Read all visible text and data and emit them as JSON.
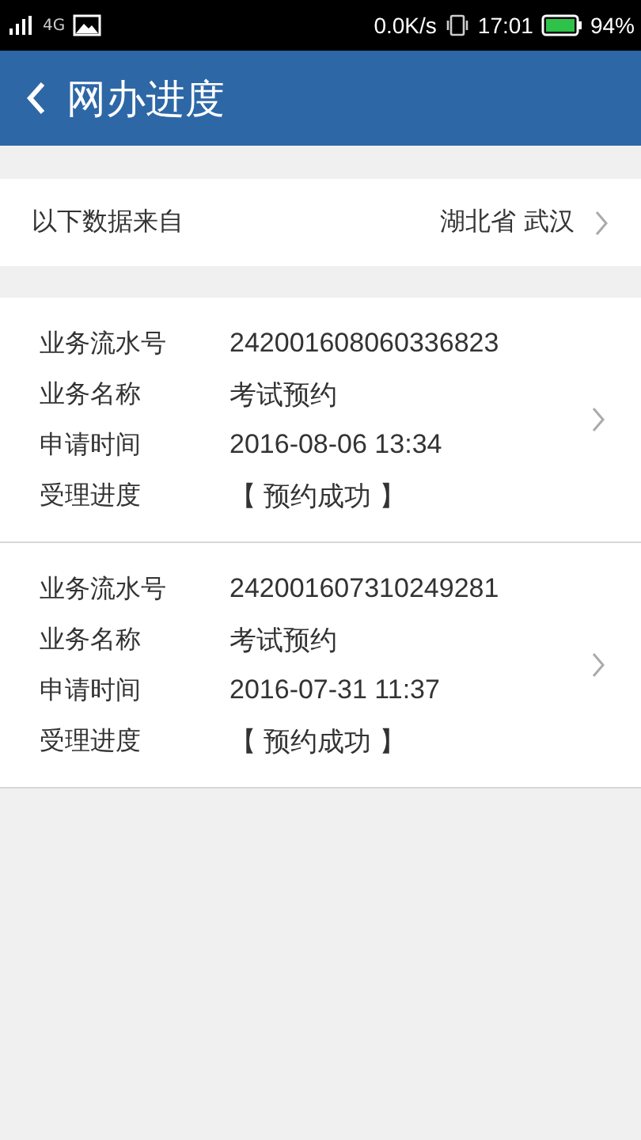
{
  "status_bar": {
    "network": "4G",
    "speed": "0.0K/s",
    "time": "17:01",
    "battery": "94%"
  },
  "header": {
    "title": "网办进度"
  },
  "source": {
    "label": "以下数据来自",
    "value": "湖北省 武汉"
  },
  "records": [
    {
      "fields": [
        {
          "label": "业务流水号",
          "value": "242001608060336823"
        },
        {
          "label": "业务名称",
          "value": "考试预约"
        },
        {
          "label": "申请时间",
          "value": "2016-08-06 13:34"
        },
        {
          "label": "受理进度",
          "value": "【 预约成功 】"
        }
      ]
    },
    {
      "fields": [
        {
          "label": "业务流水号",
          "value": "242001607310249281"
        },
        {
          "label": "业务名称",
          "value": "考试预约"
        },
        {
          "label": "申请时间",
          "value": "2016-07-31 11:37"
        },
        {
          "label": "受理进度",
          "value": "【 预约成功 】"
        }
      ]
    }
  ]
}
